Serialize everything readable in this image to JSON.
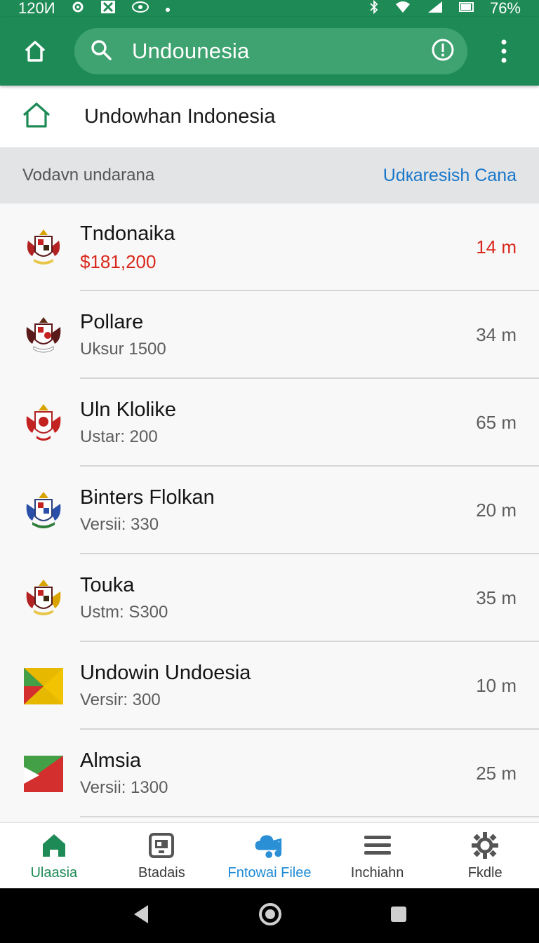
{
  "status_bar": {
    "time": "120И",
    "battery": "76%",
    "left_icons": [
      "settings-icon",
      "app-icon",
      "eye-icon",
      "dot-icon"
    ],
    "right_icons": [
      "bluetooth-icon",
      "wifi-icon",
      "signal-icon",
      "battery-icon"
    ]
  },
  "app_bar": {
    "home_icon": "home-icon",
    "search_query": "Undounesia",
    "search_icon": "search-icon",
    "info_icon": "info-icon",
    "more_icon": "more-vert-icon",
    "color": "#1e8a55"
  },
  "home_row": {
    "label": "Undowhan Indonesia",
    "icon": "home-outline-icon"
  },
  "section": {
    "title": "Vodavn undarana",
    "action": "Udкaresish Cana"
  },
  "list": [
    {
      "title": "Tndonaika",
      "subtitle": "$181,200",
      "distance": "14 m",
      "icon": "coat-of-arms-icon",
      "highlight": true
    },
    {
      "title": "Pollare",
      "subtitle": "Uksur 1500",
      "distance": "34 m",
      "icon": "coat-of-arms-icon",
      "highlight": false
    },
    {
      "title": "Uln Klolike",
      "subtitle": "Ustar: 200",
      "distance": "65 m",
      "icon": "coat-of-arms-icon",
      "highlight": false
    },
    {
      "title": "Binters Flolkan",
      "subtitle": "Versii: 330",
      "distance": "20 m",
      "icon": "coat-of-arms-icon",
      "highlight": false
    },
    {
      "title": "Touka",
      "subtitle": "Ustm: S300",
      "distance": "35 m",
      "icon": "coat-of-arms-icon",
      "highlight": false
    },
    {
      "title": "Undowin Undoesia",
      "subtitle": "Versir: 300",
      "distance": "10 m",
      "icon": "flag-tiles-icon",
      "highlight": false
    },
    {
      "title": "Almsia",
      "subtitle": "Versii: 1300",
      "distance": "25 m",
      "icon": "flag-triangle-icon",
      "highlight": false
    }
  ],
  "bottom_nav": [
    {
      "label": "Ulaasia",
      "icon": "home-filled-icon",
      "state": "active"
    },
    {
      "label": "Btadais",
      "icon": "document-icon",
      "state": "normal"
    },
    {
      "label": "Fntowai Filee",
      "icon": "cloud-music-icon",
      "state": "highlight"
    },
    {
      "label": "Inchiahn",
      "icon": "menu-icon",
      "state": "normal"
    },
    {
      "label": "Fkdle",
      "icon": "gear-icon",
      "state": "normal"
    }
  ],
  "colors": {
    "primary": "#1e8a55",
    "accent_blue": "#1877c9",
    "alert_red": "#d8281c"
  }
}
